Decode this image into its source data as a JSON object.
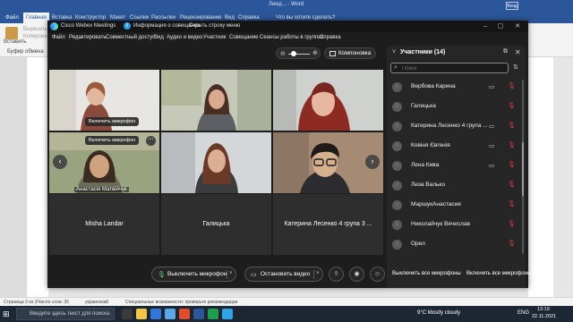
{
  "word": {
    "title": "Лекці... - Word",
    "sign_in": "Вход",
    "tabs": [
      "Файл",
      "Главная",
      "Вставка",
      "Конструктор",
      "Макет",
      "Ссылки",
      "Рассылки",
      "Рецензирование",
      "Вид",
      "Справка",
      "Что вы хотите сделать?"
    ],
    "ribbon": {
      "paste": "Вставить",
      "cut": "Вырезать",
      "copy": "Копировать",
      "clipboard": "Буфер обмена"
    },
    "status": {
      "page": "Страница 3 из 3",
      "words": "Число слов: 35",
      "lang": "украинский",
      "accessibility": "Специальные возможности: проверьте рекомендации"
    }
  },
  "taskbar": {
    "search_placeholder": "Введите здесь текст для поиска",
    "weather": "9°C  Mostly cloudy",
    "lang": "ENG",
    "time": "13:19",
    "date": "22.11.2021"
  },
  "webex": {
    "app_name": "Cisco Webex Meetings",
    "info_label": "Информация о совещании",
    "hide_menu": "Скрыть строку меню",
    "menu": [
      "Файл",
      "Редактировать",
      "Совместный доступ",
      "Вид",
      "Аудио и видео",
      "Участник",
      "Совещание",
      "Сеансы работы в группах",
      "Справка"
    ],
    "layout_label": "Компоновка",
    "tiles": {
      "t1_tooltip": "Включить микрофон",
      "t4_tooltip": "Включить микрофон",
      "t4_name": "Анастасія Матвійчук",
      "t7_name": "Misha Landar",
      "t8_name": "Галицька",
      "t9_name": "Катерина Лесенко 4 група 3 ..."
    },
    "toolbar": {
      "mute_label": "Выключить микрофон",
      "video_label": "Остановить видео"
    },
    "panel": {
      "title": "Участники (14)",
      "search_placeholder": "Поиск",
      "participants": [
        {
          "name": "Вербова Карина",
          "camera": true
        },
        {
          "name": "Галицька",
          "camera": false
        },
        {
          "name": "Катерина Лесенко 4 група ...",
          "camera": true
        },
        {
          "name": "Ковіня Євгенія",
          "camera": true
        },
        {
          "name": "Лена Кива",
          "camera": true
        },
        {
          "name": "Лиза Валько",
          "camera": false
        },
        {
          "name": "МаршукАнастасия",
          "camera": false
        },
        {
          "name": "Николайчук Вячеслав",
          "camera": false
        },
        {
          "name": "Орел",
          "camera": false
        }
      ],
      "mute_all": "Выключить все микрофоны",
      "unmute_all": "Включить все микрофоны"
    }
  }
}
